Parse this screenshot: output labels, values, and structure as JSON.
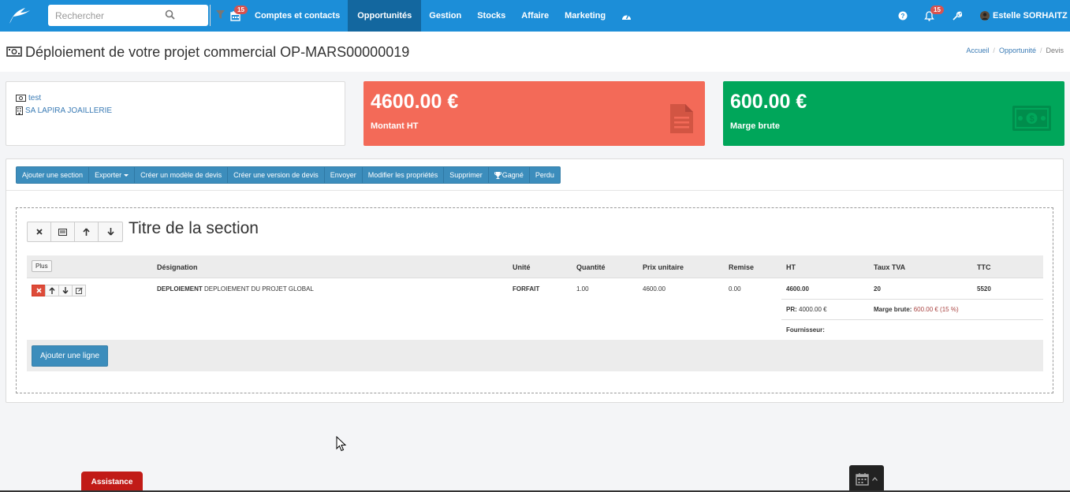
{
  "navbar": {
    "search_placeholder": "Rechercher",
    "calendar_badge": "15",
    "items": [
      {
        "label": "Comptes et contacts"
      },
      {
        "label": "Opportunités"
      },
      {
        "label": "Gestion"
      },
      {
        "label": "Stocks"
      },
      {
        "label": "Affaire"
      },
      {
        "label": "Marketing"
      }
    ],
    "notifications_badge": "15",
    "user_name": "Estelle SORHAITZ",
    "accent_color": "#1c8ed8",
    "active_color": "#13679f"
  },
  "page": {
    "title": "Déploiement de votre projet commercial OP-MARS00000019",
    "breadcrumb": [
      "Accueil",
      "Opportunité",
      "Devis"
    ]
  },
  "info": {
    "link_1": "test",
    "link_2": "SA LAPIRA JOAILLERIE"
  },
  "kpis": {
    "amount_value": "4600.00 €",
    "amount_label": "Montant HT",
    "margin_value": "600.00 €",
    "margin_label": "Marge brute",
    "red_color": "#f36a58",
    "green_color": "#00a65a"
  },
  "toolbar": {
    "add_section": "Ajouter une section",
    "export": "Exporter",
    "create_template": "Créer un modèle de devis",
    "create_version": "Créer une version de devis",
    "send": "Envoyer",
    "edit_properties": "Modifier les propriétés",
    "delete": "Supprimer",
    "won": "Gagné",
    "lost": "Perdu"
  },
  "section": {
    "title": "Titre de la section",
    "plus_label": "Plus",
    "columns": {
      "designation": "Désignation",
      "unit": "Unité",
      "quantity": "Quantité",
      "unit_price": "Prix unitaire",
      "discount": "Remise",
      "ht": "HT",
      "vat": "Taux TVA",
      "ttc": "TTC"
    },
    "row": {
      "code": "DEPLOIEMENT",
      "description": "DEPLOIEMENT DU PROJET GLOBAL",
      "unit": "FORFAIT",
      "quantity": "1.00",
      "unit_price": "4600.00",
      "discount": "0.00",
      "ht": "4600.00",
      "vat": "20",
      "ttc": "5520",
      "pr_label": "PR:",
      "pr_value": "4000.00 €",
      "margin_label": "Marge brute:",
      "margin_value": "600.00 € (15 %)",
      "supplier_label": "Fournisseur:"
    },
    "add_line": "Ajouter une ligne"
  },
  "footer": {
    "assistance": "Assistance"
  }
}
